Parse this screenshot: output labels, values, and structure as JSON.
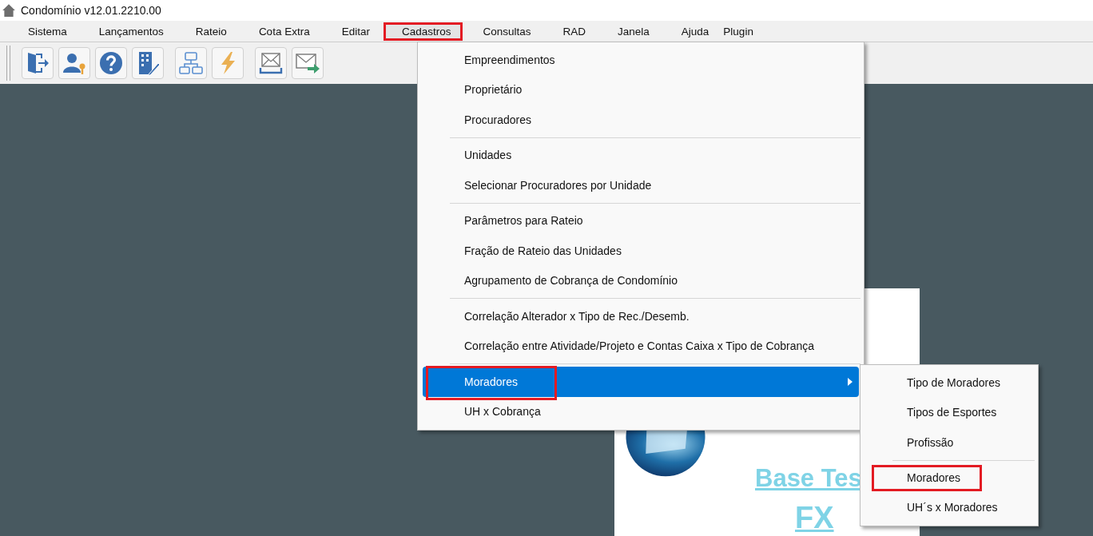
{
  "window": {
    "title": "Condomínio v12.01.2210.00"
  },
  "menubar": [
    {
      "label": "Sistema",
      "open": false,
      "highlighted": false
    },
    {
      "label": "Lançamentos",
      "open": false,
      "highlighted": false
    },
    {
      "label": "Rateio",
      "open": false,
      "highlighted": false
    },
    {
      "label": "Cota Extra",
      "open": false,
      "highlighted": false
    },
    {
      "label": "Editar",
      "open": false,
      "highlighted": false
    },
    {
      "label": "Cadastros",
      "open": true,
      "highlighted": true
    },
    {
      "label": "Consultas",
      "open": false,
      "highlighted": false
    },
    {
      "label": "RAD",
      "open": false,
      "highlighted": false
    },
    {
      "label": "Janela",
      "open": false,
      "highlighted": false
    },
    {
      "label": "Ajuda",
      "open": false,
      "highlighted": false
    },
    {
      "label": "Plugin",
      "open": false,
      "highlighted": false
    }
  ],
  "background_card": {
    "links": [
      "Base Tes",
      "FX"
    ]
  },
  "cadastros_menu": {
    "groups": [
      [
        {
          "label": "Empreendimentos",
          "selected": false,
          "highlighted": false,
          "submenu": false
        },
        {
          "label": "Proprietário",
          "selected": false,
          "highlighted": false,
          "submenu": false
        },
        {
          "label": "Procuradores",
          "selected": false,
          "highlighted": false,
          "submenu": false
        }
      ],
      [
        {
          "label": "Unidades",
          "selected": false,
          "highlighted": false,
          "submenu": false
        },
        {
          "label": "Selecionar Procuradores por Unidade",
          "selected": false,
          "highlighted": false,
          "submenu": false
        }
      ],
      [
        {
          "label": "Parâmetros para Rateio",
          "selected": false,
          "highlighted": false,
          "submenu": false
        },
        {
          "label": "Fração de Rateio das Unidades",
          "selected": false,
          "highlighted": false,
          "submenu": false
        },
        {
          "label": "Agrupamento de Cobrança de Condomínio",
          "selected": false,
          "highlighted": false,
          "submenu": false
        }
      ],
      [
        {
          "label": "Correlação Alterador x Tipo de Rec./Desemb.",
          "selected": false,
          "highlighted": false,
          "submenu": false
        },
        {
          "label": "Correlação entre Atividade/Projeto e Contas Caixa x Tipo de Cobrança",
          "selected": false,
          "highlighted": false,
          "submenu": false
        }
      ],
      [
        {
          "label": "Moradores",
          "selected": true,
          "highlighted": true,
          "submenu": true
        },
        {
          "label": "UH x Cobrança",
          "selected": false,
          "highlighted": false,
          "submenu": false
        }
      ]
    ]
  },
  "moradores_submenu": {
    "groups": [
      [
        {
          "label": "Tipo de Moradores",
          "selected": false,
          "highlighted": false
        },
        {
          "label": "Tipos de Esportes",
          "selected": false,
          "highlighted": false
        },
        {
          "label": "Profissão",
          "selected": false,
          "highlighted": false
        }
      ],
      [
        {
          "label": "Moradores",
          "selected": false,
          "highlighted": true
        },
        {
          "label": "UH´s x Moradores",
          "selected": false,
          "highlighted": false
        }
      ]
    ]
  }
}
